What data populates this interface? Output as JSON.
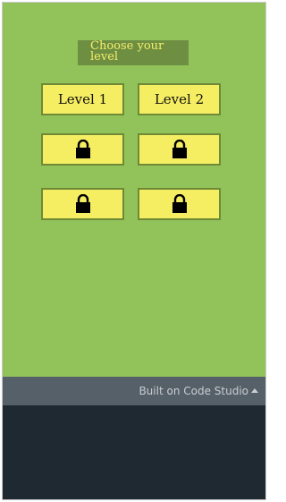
{
  "header": {
    "title": "Choose your level"
  },
  "levels": [
    {
      "label": "Level 1",
      "locked": false
    },
    {
      "label": "Level 2",
      "locked": false
    },
    {
      "label": "",
      "locked": true,
      "icon": "lock-icon"
    },
    {
      "label": "",
      "locked": true,
      "icon": "lock-icon"
    },
    {
      "label": "",
      "locked": true,
      "icon": "lock-icon"
    },
    {
      "label": "",
      "locked": true,
      "icon": "lock-icon"
    }
  ],
  "footer": {
    "link_label": "Built on Code Studio",
    "icon": "caret-up-icon"
  },
  "colors": {
    "background": "#92c25a",
    "button": "#f6ee62",
    "title_bg": "#6e8e42",
    "title_text": "#f4ee6a",
    "footer_bar": "#566069",
    "page_bg": "#1e2932"
  }
}
